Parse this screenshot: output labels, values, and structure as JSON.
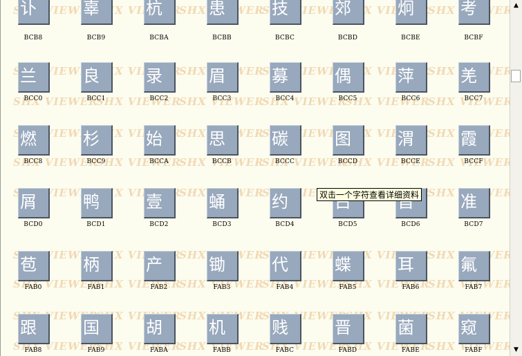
{
  "tooltip": "双击一个字符查看详细资料",
  "watermark": "SHX VIEWER",
  "scrollbar": {
    "up_icon": "▲",
    "down_icon": "▼"
  },
  "rows": [
    [
      {
        "glyph": "讣",
        "code": "BCB8"
      },
      {
        "glyph": "辜",
        "code": "BCB9"
      },
      {
        "glyph": "杭",
        "code": "BCBA"
      },
      {
        "glyph": "患",
        "code": "BCBB"
      },
      {
        "glyph": "技",
        "code": "BCBC"
      },
      {
        "glyph": "郊",
        "code": "BCBD"
      },
      {
        "glyph": "炯",
        "code": "BCBE"
      },
      {
        "glyph": "考",
        "code": "BCBF"
      }
    ],
    [
      {
        "glyph": "兰",
        "code": "BCC0"
      },
      {
        "glyph": "良",
        "code": "BCC1"
      },
      {
        "glyph": "录",
        "code": "BCC2"
      },
      {
        "glyph": "眉",
        "code": "BCC3"
      },
      {
        "glyph": "募",
        "code": "BCC4"
      },
      {
        "glyph": "偶",
        "code": "BCC5"
      },
      {
        "glyph": "萍",
        "code": "BCC6"
      },
      {
        "glyph": "羌",
        "code": "BCC7"
      }
    ],
    [
      {
        "glyph": "燃",
        "code": "BCC8"
      },
      {
        "glyph": "杉",
        "code": "BCC9"
      },
      {
        "glyph": "始",
        "code": "BCCA"
      },
      {
        "glyph": "思",
        "code": "BCCB"
      },
      {
        "glyph": "碳",
        "code": "BCCC"
      },
      {
        "glyph": "图",
        "code": "BCCD"
      },
      {
        "glyph": "渭",
        "code": "BCCE"
      },
      {
        "glyph": "霞",
        "code": "BCCF"
      }
    ],
    [
      {
        "glyph": "屑",
        "code": "BCD0"
      },
      {
        "glyph": "鸭",
        "code": "BCD1"
      },
      {
        "glyph": "壹",
        "code": "BCD2"
      },
      {
        "glyph": "蛹",
        "code": "BCD3"
      },
      {
        "glyph": "约",
        "code": "BCD4"
      },
      {
        "glyph": "占",
        "code": "BCD5"
      },
      {
        "glyph": "旨",
        "code": "BCD6"
      },
      {
        "glyph": "准",
        "code": "BCD7"
      }
    ],
    [
      {
        "glyph": "苞",
        "code": "FAB0"
      },
      {
        "glyph": "柄",
        "code": "FAB1"
      },
      {
        "glyph": "产",
        "code": "FAB2"
      },
      {
        "glyph": "锄",
        "code": "FAB3"
      },
      {
        "glyph": "代",
        "code": "FAB4"
      },
      {
        "glyph": "蝶",
        "code": "FAB5"
      },
      {
        "glyph": "耳",
        "code": "FAB6"
      },
      {
        "glyph": "氟",
        "code": "FAB7"
      }
    ],
    [
      {
        "glyph": "跟",
        "code": "FAB8"
      },
      {
        "glyph": "国",
        "code": "FAB9"
      },
      {
        "glyph": "胡",
        "code": "FABA"
      },
      {
        "glyph": "机",
        "code": "FABB"
      },
      {
        "glyph": "贱",
        "code": "FABC"
      },
      {
        "glyph": "晋",
        "code": "FABD"
      },
      {
        "glyph": "菌",
        "code": "FABE"
      },
      {
        "glyph": "窥",
        "code": "FABF"
      }
    ]
  ]
}
